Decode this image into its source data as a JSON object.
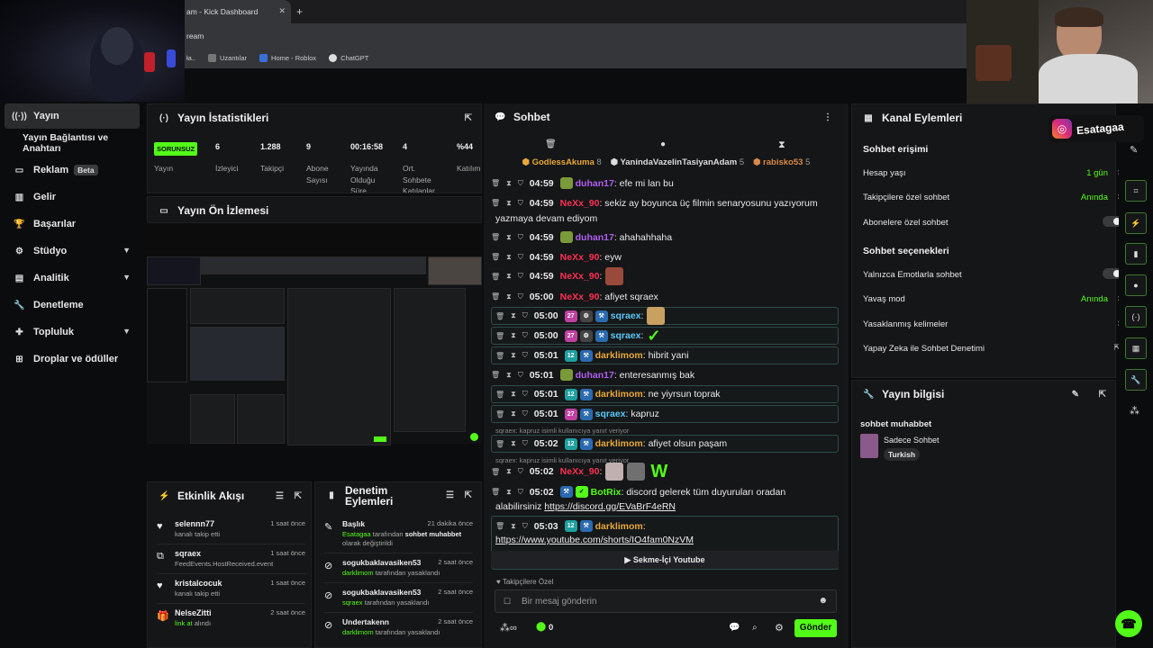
{
  "browser": {
    "tab_title": "am - Kick Dashboard",
    "url": "ream",
    "bookmarks": [
      "ła..",
      "Uzantılar",
      "Home - Roblox",
      "ChatGPT"
    ]
  },
  "sidebar": {
    "items": [
      {
        "label": "Yayın",
        "icon": "broadcast-icon"
      },
      {
        "label": "Yayın Bağlantısı ve Anahtarı"
      },
      {
        "label": "Reklam",
        "badge": "Beta",
        "icon": "monitor-icon"
      },
      {
        "label": "Gelir",
        "icon": "chart-icon"
      },
      {
        "label": "Başarılar",
        "icon": "trophy-icon"
      },
      {
        "label": "Stüdyo",
        "icon": "studio-icon"
      },
      {
        "label": "Analitik",
        "icon": "analytics-icon"
      },
      {
        "label": "Denetleme",
        "icon": "wrench-icon"
      },
      {
        "label": "Topluluk",
        "icon": "community-icon"
      },
      {
        "label": "Droplar ve ödüller",
        "icon": "drops-icon"
      }
    ]
  },
  "stats": {
    "title": "Yayın İstatistikleri",
    "status_tag": "SORUNSUZ",
    "status_label": "Yayın",
    "values": [
      {
        "value": "6",
        "label": "İzleyici"
      },
      {
        "value": "1.288",
        "label": "Takipçi"
      },
      {
        "value": "9",
        "label": "Abone Sayısı"
      },
      {
        "value": "00:16:58",
        "label": "Yayında Olduğu Süre"
      },
      {
        "value": "4",
        "label": "Ort. Sohbete Katılanlar"
      },
      {
        "value": "%44",
        "label": "Katılım"
      }
    ]
  },
  "preview": {
    "title": "Yayın Ön İzlemesi"
  },
  "activity": {
    "title": "Etkinlik Akışı",
    "rows": [
      {
        "name": "selennn77",
        "sub": "kanalı takip etti",
        "time": "1 saat önce"
      },
      {
        "name": "sqraex",
        "sub": "FeedEvents.HostReceived.event",
        "time": "1 saat önce"
      },
      {
        "name": "kristalcocuk",
        "sub": "kanalı takip etti",
        "time": "1 saat önce"
      },
      {
        "name": "NelseZitti",
        "sub_hl": "link at",
        "sub": "alındı",
        "time": "2 saat önce"
      }
    ]
  },
  "mod": {
    "title": "Denetim Eylemleri",
    "rows": [
      {
        "title": "Başlık",
        "time": "21 dakika önce",
        "actor": "Esatagaa",
        "mid": "tarafından",
        "bold": "sohbet muhabbet",
        "sub": "olarak değiştirildi"
      },
      {
        "title": "sogukbaklavasiken53",
        "time": "2 saat önce",
        "actor": "darklimom",
        "sub": "tarafından yasaklandı"
      },
      {
        "title": "sogukbaklavasiken53",
        "time": "2 saat önce",
        "actor": "sqraex",
        "sub": "tarafından yasaklandı"
      },
      {
        "title": "Undertakenn",
        "time": "2 saat önce",
        "actor": "darklimom",
        "sub": "tarafından yasaklandı"
      }
    ]
  },
  "chat": {
    "title": "Sohbet",
    "top_gifters": [
      {
        "name": "GodlessAkuma",
        "count": "8",
        "color": "#e8a83a"
      },
      {
        "name": "YanindaVazelinTasiyanAdam",
        "count": "5",
        "color": "#dddddd"
      },
      {
        "name": "rabisko53",
        "count": "5",
        "color": "#d98a4a"
      }
    ],
    "messages": [
      {
        "time": "04:59",
        "user": "duhan17",
        "color": "#b05ef0",
        "text": "efe mi lan bu"
      },
      {
        "time": "04:59",
        "user": "NeXx_90",
        "color": "#ff2e55",
        "text": "sekiz ay boyunca üç filmin senaryosunu yazıyorum",
        "text2": "yazmaya devam ediyom"
      },
      {
        "time": "04:59",
        "user": "duhan17",
        "color": "#b05ef0",
        "text": "ahahahhaha"
      },
      {
        "time": "04:59",
        "user": "NeXx_90",
        "color": "#ff2e55",
        "text": "eyw"
      },
      {
        "time": "04:59",
        "user": "NeXx_90",
        "color": "#ff2e55",
        "text": ""
      },
      {
        "time": "05:00",
        "user": "NeXx_90",
        "color": "#ff2e55",
        "text": "afiyet sqraex"
      },
      {
        "time": "05:00",
        "user": "sqraex",
        "color": "#5ac8fa",
        "text": ""
      },
      {
        "time": "05:00",
        "user": "sqraex",
        "color": "#5ac8fa",
        "text": ""
      },
      {
        "time": "05:01",
        "user": "darklimom",
        "color": "#e8a83a",
        "text": "hibrit yani"
      },
      {
        "time": "05:01",
        "user": "duhan17",
        "color": "#b05ef0",
        "text": "enteresanmış bak"
      },
      {
        "time": "05:01",
        "user": "darklimom",
        "color": "#e8a83a",
        "text": "ne yiyrsun toprak"
      },
      {
        "time": "05:01",
        "user": "sqraex",
        "color": "#5ac8fa",
        "text": "kapruz"
      },
      {
        "reply": "sqraex: kapruz isimli kullanıcıya yanıt veriyor",
        "time": "05:02",
        "user": "darklimom",
        "color": "#e8a83a",
        "text": "afiyet olsun paşam"
      },
      {
        "reply": "sqraex: kapruz isimli kullanıcıya yanıt veriyor",
        "time": "05:02",
        "user": "NeXx_90",
        "color": "#ff2e55",
        "text": ""
      },
      {
        "time": "05:02",
        "user": "BotRix",
        "color": "#53fc18",
        "text": "discord gelerek tüm duyuruları oradan",
        "text2": "alabilirsiniz",
        "link": "https://discord.gg/EVaBrF4eRN"
      },
      {
        "time": "05:03",
        "user": "darklimom",
        "color": "#e8a83a",
        "text": "",
        "link": "https://www.youtube.com/shorts/IO4fam0NzVM",
        "button": "Sekme-İçi Youtube"
      }
    ],
    "followers_only": "Takipçilere Özel",
    "input_placeholder": "Bir mesaj gönderin",
    "points": "0",
    "send": "Gönder",
    "emote_w": "W"
  },
  "channel_actions": {
    "title": "Kanal Eylemleri",
    "section1": "Sohbet erişimi",
    "rows1": [
      {
        "label": "Hesap yaşı",
        "value": "1 gün"
      },
      {
        "label": "Takipçilere özel sohbet",
        "value": "Anında"
      },
      {
        "label": "Abonelere özel sohbet"
      }
    ],
    "section2": "Sohbet seçenekleri",
    "rows2": [
      {
        "label": "Yalnızca Emotlarla sohbet"
      },
      {
        "label": "Yavaş mod",
        "value": "Anında"
      },
      {
        "label": "Yasaklanmış kelimeler"
      },
      {
        "label": "Yapay Zeka ile Sohbet Denetimi"
      }
    ]
  },
  "stream_info": {
    "title": "Yayın bilgisi",
    "stream_title": "sohbet muhabbet",
    "category": "Sadece Sohbet",
    "tag": "Turkish"
  },
  "overlay": {
    "instagram": "Esatagaa"
  }
}
